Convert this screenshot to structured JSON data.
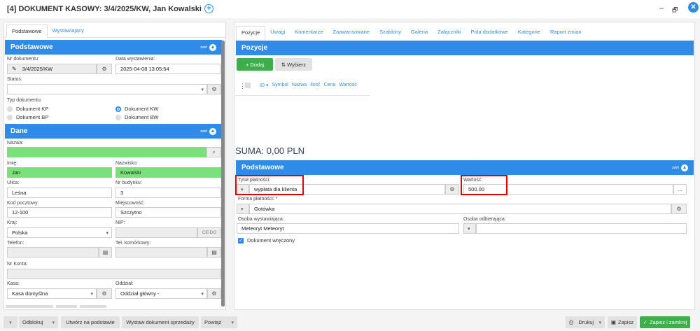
{
  "window": {
    "title": "[4] DOKUMENT KASOWY: 3/4/2025/KW, Jan Kowalski",
    "minimize": "–",
    "restore": "🗗",
    "close": "✕"
  },
  "left": {
    "tabs": [
      "Podstawowe",
      "Wystawiający"
    ],
    "podstawowe": {
      "header": "Podstawowe",
      "collapse": "zwiń",
      "nr_label": "Nr dokumentu:",
      "nr_value": "3/4/2025/KW",
      "data_label": "Data wystawienia:",
      "data_value": "2025-04-08 13:05:54",
      "status_label": "Status:",
      "status_value": "",
      "typ_label": "Typ dokumentu:",
      "typ_options": [
        "Dokument KP",
        "Dokument KW",
        "Dokument BP",
        "Dokument BW"
      ],
      "typ_selected": "Dokument KW"
    },
    "dane": {
      "header": "Dane",
      "collapse": "zwiń",
      "nazwa_label": "Nazwa:",
      "nazwa_value": "",
      "imie_label": "Imię:",
      "imie_value": "Jan",
      "nazwisko_label": "Nazwisko:",
      "nazwisko_value": "Kowalski",
      "ulica_label": "Ulica:",
      "ulica_value": "Leśna",
      "nr_budynku_label": "Nr budynku:",
      "nr_budynku_value": "3",
      "kod_label": "Kod pocztowy:",
      "kod_value": "12-100",
      "miejscowosc_label": "Miejscowość:",
      "miejscowosc_value": "Szczytno",
      "kraj_label": "Kraj:",
      "kraj_value": "Polska",
      "nip_label": "NIP:",
      "nip_value": "",
      "ceidg": "CEIDG",
      "telefon_label": "Telefon:",
      "telefon_value": "",
      "tel_kom_label": "Tel. komórkowy:",
      "tel_kom_value": "",
      "nr_konta_label": "Nr Konta:",
      "nr_konta_value": "",
      "kasa_label": "Kasa:",
      "kasa_value": "Kasa domyślna",
      "oddzial_label": "Oddział:",
      "oddzial_value": "Oddział główny -"
    }
  },
  "right": {
    "tabs": [
      "Pozycje",
      "Uwagi",
      "Komentarze",
      "Zaawansowane",
      "Szablony",
      "Galeria",
      "Załączniki",
      "Pola dodatkowe",
      "Kategorie",
      "Raport zmian"
    ],
    "pozycje_header": "Pozycje",
    "dodaj": "+ Dodaj",
    "wybierz": "⇅ Wybierz",
    "columns": [
      "ID ▾",
      "Symbol",
      "Nazwa",
      "Ilość",
      "Cena",
      "Wartość"
    ],
    "suma": "SUMA: 0,00 PLN",
    "podstawowe_header": "Podstawowe",
    "collapse": "zwiń",
    "tytul_label": "Tytuł płatności:",
    "tytul_value": "wypłata dla klienta",
    "wartosc_label": "Wartość:",
    "wartosc_value": "500.00",
    "wartosc_btn": "...",
    "forma_label": "Forma płatności: *",
    "forma_value": "Gotówka",
    "osoba_wyst_label": "Osoba wystawiająca:",
    "osoba_wyst_value": "Meteoryt Meteoryt",
    "osoba_odb_label": "Osoba odbierająca:",
    "osoba_odb_value": "",
    "wreczony_label": "Dokument wręczony",
    "wreczony_checked": true
  },
  "bottom": {
    "odblokuj": "Odblokuj",
    "utworz": "Utwórz na podstawie",
    "wystaw": "Wystaw dokument sprzedaży",
    "powiaz": "Powiąż",
    "drukuj": "Drukuj",
    "zapisz": "Zapisz",
    "zapisz_zamknij": "Zapisz i zamknij"
  },
  "colors": {
    "accent": "#2e8ce8",
    "green": "#7ae07a",
    "save": "#3cae4a",
    "highlight": "#e00000"
  }
}
